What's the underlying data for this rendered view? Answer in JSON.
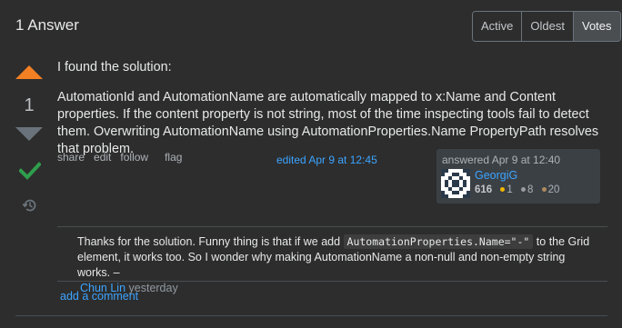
{
  "header": {
    "title": "1 Answer"
  },
  "sort_tabs": [
    {
      "label": "Active",
      "selected": false
    },
    {
      "label": "Oldest",
      "selected": false
    },
    {
      "label": "Votes",
      "selected": true
    }
  ],
  "vote": {
    "count": "1",
    "up_icon": "arrow-up-icon",
    "down_icon": "arrow-down-icon",
    "accepted_icon": "checkmark-icon",
    "history_icon": "history-icon",
    "up_color": "#f48024",
    "accepted_color": "#2f9e4c"
  },
  "post": {
    "paragraph_1": "I found the solution:",
    "paragraph_2": "AutomationId and AutomationName are automatically mapped to x:Name and Content properties. If the content property is not string, most of the time inspecting tools fail to detect them. Overwriting AutomationName using AutomationProperties.Name PropertyPath resolves that problem."
  },
  "post_menu": {
    "share": "share",
    "edit": "edit",
    "follow": "follow",
    "flag": "flag"
  },
  "edited": "edited Apr 9 at 12:45",
  "user_card": {
    "answered": "answered Apr 9 at 12:40",
    "name": "GeorgiG",
    "reputation": "616",
    "gold": "1",
    "silver": "8",
    "bronze": "20",
    "gold_color": "#f1b600",
    "silver_color": "#9a9c9f",
    "bronze_color": "#ab8a5f"
  },
  "comment": {
    "text_before": "Thanks for the solution. Funny thing is that if we add ",
    "code": "AutomationProperties.Name=\"-\"",
    "text_after": " to the Grid element, it works too. So I wonder why making AutomationName a non-null and non-empty string works. –",
    "user": "Chun Lin",
    "date": " yesterday"
  },
  "add_comment": "add a comment"
}
